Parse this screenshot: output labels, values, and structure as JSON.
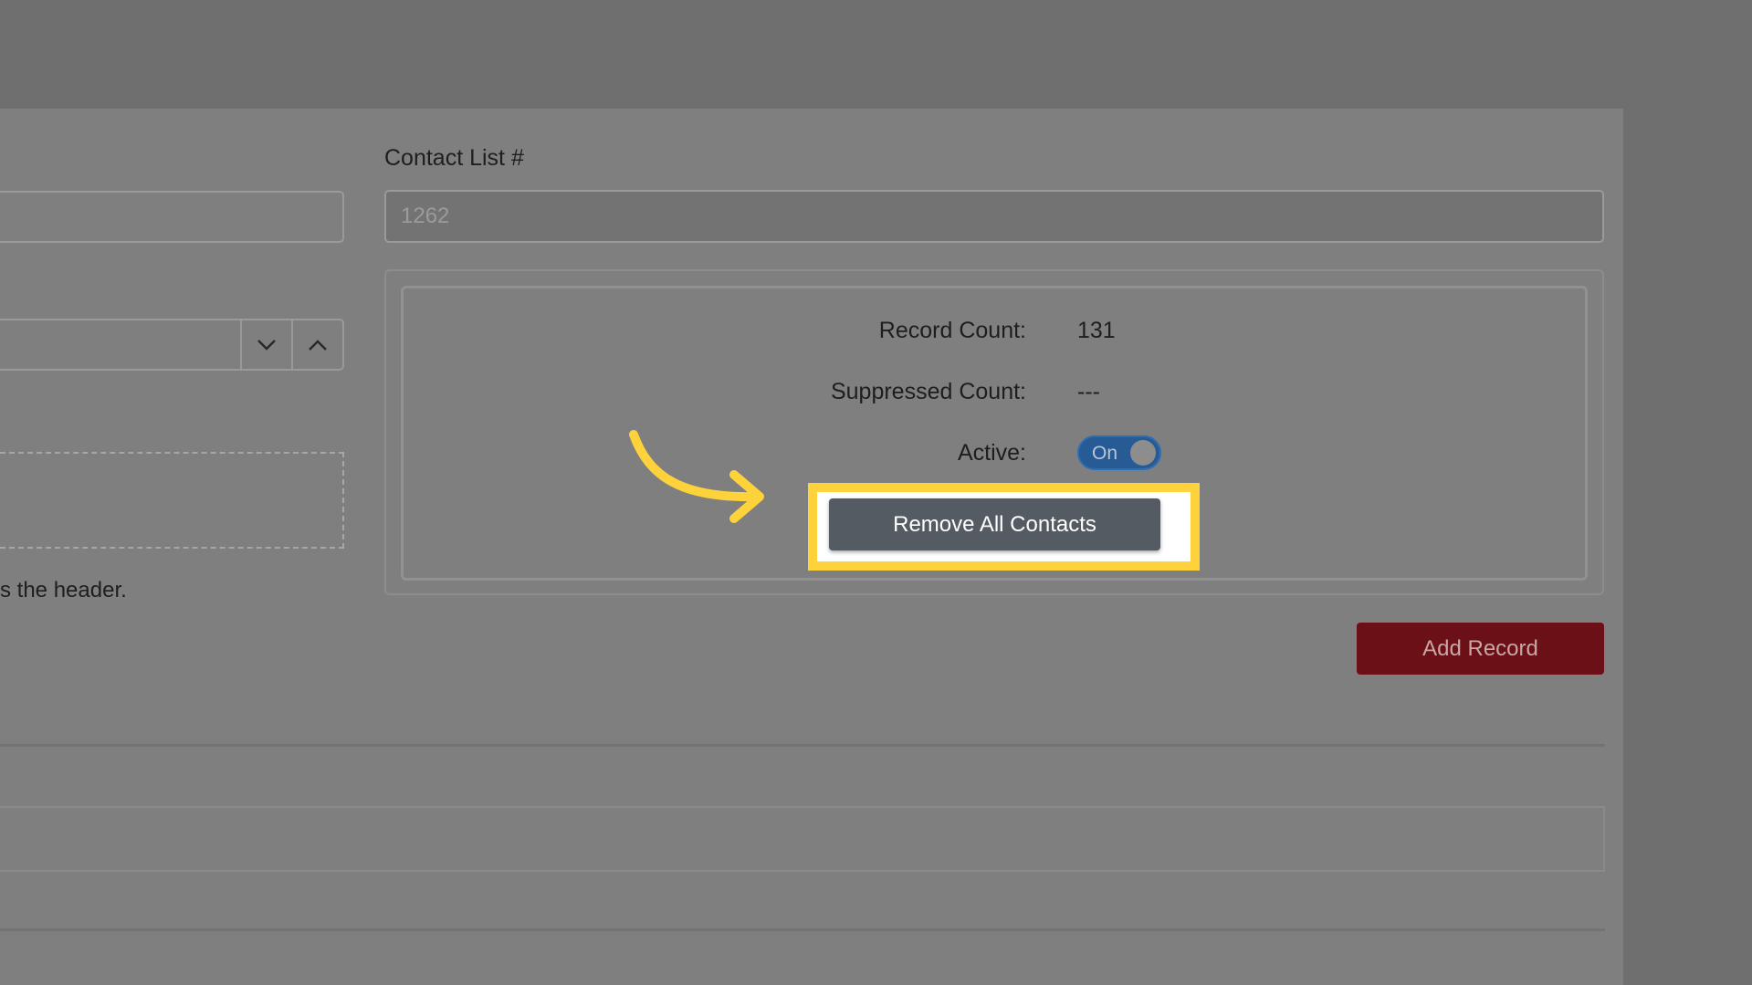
{
  "contact_list": {
    "label": "Contact List #",
    "value": "1262"
  },
  "stats": {
    "record_count_label": "Record Count:",
    "record_count_value": "131",
    "suppressed_count_label": "Suppressed Count:",
    "suppressed_count_value": "---",
    "active_label": "Active:",
    "active_toggle_label": "On"
  },
  "buttons": {
    "remove_all_contacts": "Remove All Contacts",
    "add_record": "Add Record"
  },
  "hint_text": "s the header.",
  "icons": {
    "stepper_down": "chevron-down-icon",
    "stepper_up": "chevron-up-icon",
    "callout": "curved-arrow-icon"
  },
  "colors": {
    "highlight": "#fdd23a",
    "add_record": "#6b1017",
    "toggle_on": "#275b95"
  }
}
